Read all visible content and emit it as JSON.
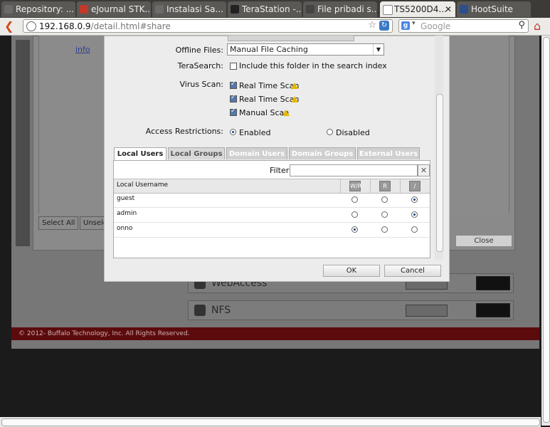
{
  "browser": {
    "tabs": [
      {
        "label": "Repository: ...",
        "favicon_color": "#6b6b6b"
      },
      {
        "label": "eJournal STK...",
        "favicon_color": "#c0392b"
      },
      {
        "label": "Instalasi Sa...",
        "favicon_color": "#6b6b6b"
      },
      {
        "label": "TeraStation -...",
        "favicon_color": "#222222"
      },
      {
        "label": "File pribadi s...",
        "favicon_color": "#444444"
      },
      {
        "label": "TS5200D4...",
        "favicon_color": "#ffffff"
      },
      {
        "label": "HootSuite",
        "favicon_color": "#2b4e8c"
      }
    ],
    "address": {
      "host": "192.168.0.9",
      "path": "/detail.html#share"
    },
    "search_placeholder": "Google"
  },
  "background": {
    "info_link": "info",
    "select_all": "Select All",
    "unselect": "Unsele",
    "close": "Close",
    "webaccess": "WebAccess",
    "nfs": "NFS",
    "footer": "© 2012- Buffalo Technology, Inc. All Rights Reserved."
  },
  "dialog": {
    "offline_files_label": "Offline Files:",
    "offline_files_value": "Manual File Caching",
    "terasearch_label": "TeraSearch:",
    "terasearch_option": "Include this folder in the search index",
    "virus_scan_label": "Virus Scan:",
    "virus_scan_items": [
      "Real Time Scan",
      "Real Time Scan",
      "Manual Scan"
    ],
    "access_label": "Access Restrictions:",
    "access_enabled": "Enabled",
    "access_disabled": "Disabled",
    "tabs": [
      "Local Users",
      "Local Groups",
      "Domain Users",
      "Domain Groups",
      "External Users"
    ],
    "filter_label": "Filter:",
    "column_username": "Local Username",
    "perm_icons": [
      "W/R",
      "R",
      "/"
    ],
    "users": [
      {
        "name": "guest",
        "perm": 2
      },
      {
        "name": "admin",
        "perm": 2
      },
      {
        "name": "onno",
        "perm": 0
      }
    ],
    "ok": "OK",
    "cancel": "Cancel"
  }
}
